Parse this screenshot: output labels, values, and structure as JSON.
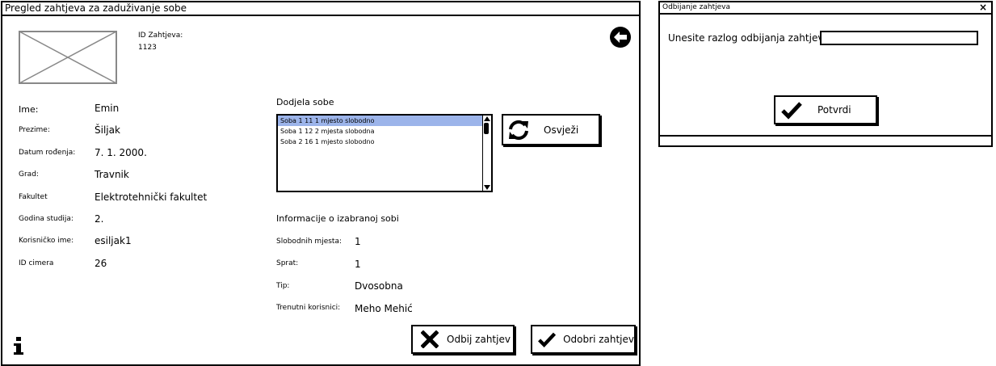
{
  "main_window": {
    "title": "Pregled zahtjeva za zaduživanje sobe",
    "request_id_label": "ID Zahtjeva:",
    "request_id_value": "1123",
    "fields": [
      {
        "label": "Ime:",
        "value": "Emin"
      },
      {
        "label": "Prezime:",
        "value": "Šiljak"
      },
      {
        "label": "Datum rođenja:",
        "value": "7. 1. 2000."
      },
      {
        "label": "Grad:",
        "value": "Travnik"
      },
      {
        "label": "Fakultet",
        "value": "Elektrotehnički fakultet"
      },
      {
        "label": "Godina studija:",
        "value": "2."
      },
      {
        "label": "Korisničko ime:",
        "value": "esiljak1"
      },
      {
        "label": "ID cimera",
        "value": "26"
      }
    ],
    "room_assign_title": "Dodjela sobe",
    "rooms": [
      "Soba 1 11  1 mjesto slobodno",
      "Soba 1 12  2 mjesta slobodna",
      "Soba 2 16  1 mjesto slobodno"
    ],
    "refresh_label": "Osvježi",
    "room_info_title": "Informacije o izabranoj sobi",
    "room_info": [
      {
        "label": "Slobodnih mjesta:",
        "value": "1"
      },
      {
        "label": "Sprat:",
        "value": "1"
      },
      {
        "label": "Tip:",
        "value": "Dvosobna"
      },
      {
        "label": "Trenutni korisnici:",
        "value": "Meho Mehić"
      }
    ],
    "reject_label": "Odbij zahtjev",
    "approve_label": "Odobri zahtjev"
  },
  "reject_dialog": {
    "title": "Odbijanje zahtjeva",
    "close_glyph": "×",
    "reason_label": "Unesite razlog odbijanja zahtjeva",
    "reason_value": "",
    "confirm_label": "Potvrdi"
  },
  "icons": [
    "image-placeholder-icon",
    "back-arrow-icon",
    "refresh-icon",
    "close-x-icon",
    "checkmark-icon",
    "info-icon"
  ]
}
